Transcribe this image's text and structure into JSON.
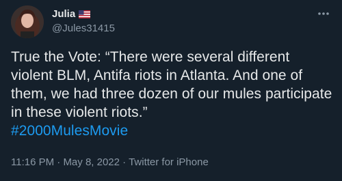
{
  "tweet": {
    "author": {
      "display_name": "Julia",
      "handle": "@Jules31415",
      "flag_icon": "us-flag-icon"
    },
    "text": "True the Vote: “There were several different violent BLM, Antifa riots in Atlanta. And one of them, we had three dozen of our mules participate in these violent riots.”",
    "hashtag": "#2000MulesMovie",
    "time": "11:16 PM",
    "separator": " · ",
    "date": "May 8, 2022",
    "source": "Twitter for iPhone"
  },
  "colors": {
    "background": "#15202b",
    "text": "#e7e9ea",
    "secondary": "#8b98a5",
    "accent": "#1d9bf0"
  }
}
